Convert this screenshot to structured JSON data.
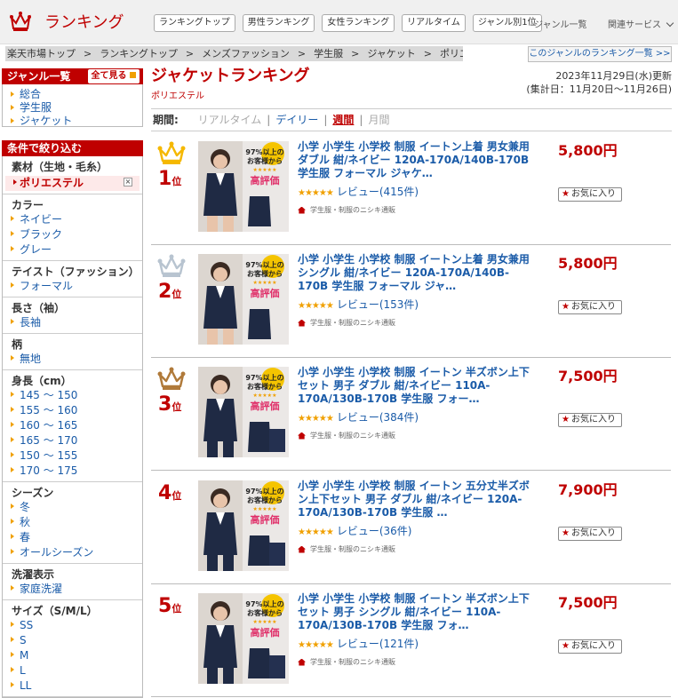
{
  "header": {
    "logo_text": "ランキング",
    "nav": [
      "ランキングトップ",
      "男性ランキング",
      "女性ランキング",
      "リアルタイム",
      "ジャンル別1位"
    ],
    "genre_list": "ジャンル一覧",
    "related": "関連サービス"
  },
  "breadcrumb": [
    "楽天市場トップ",
    "ランキングトップ",
    "メンズファッション",
    "学生服",
    "ジャケット",
    "ポリエステル"
  ],
  "genre_ranking_link": "このジャンルのランキング一覧 >>",
  "sidebar": {
    "genre_title": "ジャンル一覧",
    "see_all": "全て見る",
    "genres": [
      "総合",
      "学生服",
      "ジャケット"
    ],
    "filter_title": "条件で絞り込む",
    "material": {
      "title": "素材（生地・毛糸）",
      "selected": "ポリエステル"
    },
    "groups": [
      {
        "title": "カラー",
        "items": [
          "ネイビー",
          "ブラック",
          "グレー"
        ]
      },
      {
        "title": "テイスト（ファッション）",
        "items": [
          "フォーマル"
        ]
      },
      {
        "title": "長さ（袖）",
        "items": [
          "長袖"
        ]
      },
      {
        "title": "柄",
        "items": [
          "無地"
        ]
      },
      {
        "title": "身長（cm）",
        "items": [
          "145 ～ 150",
          "155 ～ 160",
          "160 ～ 165",
          "165 ～ 170",
          "150 ～ 155",
          "170 ～ 175"
        ]
      },
      {
        "title": "シーズン",
        "items": [
          "冬",
          "秋",
          "春",
          "オールシーズン"
        ]
      },
      {
        "title": "洗濯表示",
        "items": [
          "家庭洗濯"
        ]
      },
      {
        "title": "サイズ（S/M/L）",
        "items": [
          "SS",
          "S",
          "M",
          "L",
          "LL"
        ]
      }
    ]
  },
  "main": {
    "title": "ジャケットランキング",
    "subtitle": "ポリエステル",
    "updated": "2023年11月29日(水)更新",
    "period_range": "(集計日：11月20日～11月26日)",
    "period": {
      "label": "期間:",
      "options": [
        "リアルタイム",
        "デイリー",
        "週間",
        "月間"
      ],
      "selected": "週間"
    }
  },
  "favorite_label": "お気に入り",
  "items": [
    {
      "rank": "1",
      "rank_suffix": "位",
      "name": "小学 小学生 小学校 制服 イートン上着 男女兼用 ダブル 紺/ネイビー 120A-170A/140B-170B 学生服 フォーマル ジャケ…",
      "reviews": "レビュー(415件)",
      "shop": "学生服・制服のニシキ通販",
      "price": "5,800円",
      "crown": "gold"
    },
    {
      "rank": "2",
      "rank_suffix": "位",
      "name": "小学 小学生 小学校 制服 イートン上着 男女兼用 シングル 紺/ネイビー 120A-170A/140B-170B 学生服 フォーマル ジャ…",
      "reviews": "レビュー(153件)",
      "shop": "学生服・制服のニシキ通販",
      "price": "5,800円",
      "crown": "silver"
    },
    {
      "rank": "3",
      "rank_suffix": "位",
      "name": "小学 小学生 小学校 制服 イートン 半ズボン上下セット 男子 ダブル 紺/ネイビー 110A-170A/130B-170B 学生服 フォー…",
      "reviews": "レビュー(384件)",
      "shop": "学生服・制服のニシキ通販",
      "price": "7,500円",
      "crown": "bronze"
    },
    {
      "rank": "4",
      "rank_suffix": "位",
      "name": "小学 小学生 小学校 制服 イートン 五分丈半ズボン上下セット 男子 ダブル 紺/ネイビー 120A-170A/130B-170B 学生服 …",
      "reviews": "レビュー(36件)",
      "shop": "学生服・制服のニシキ通販",
      "price": "7,900円",
      "crown": ""
    },
    {
      "rank": "5",
      "rank_suffix": "位",
      "name": "小学 小学生 小学校 制服 イートン 半ズボン上下セット 男子 シングル 紺/ネイビー 110A-170A/130B-170B 学生服 フォ…",
      "reviews": "レビュー(121件)",
      "shop": "学生服・制服のニシキ通販",
      "price": "7,500円",
      "crown": ""
    }
  ],
  "product_badge": {
    "line1": "97%以上の",
    "line2": "お客様から",
    "line3": "高評価"
  },
  "colors": {
    "brand": "#bf0000",
    "link": "#1a5ba8",
    "gold": "#f5b800",
    "silver": "#b8c4d0",
    "bronze": "#b07a3a"
  }
}
